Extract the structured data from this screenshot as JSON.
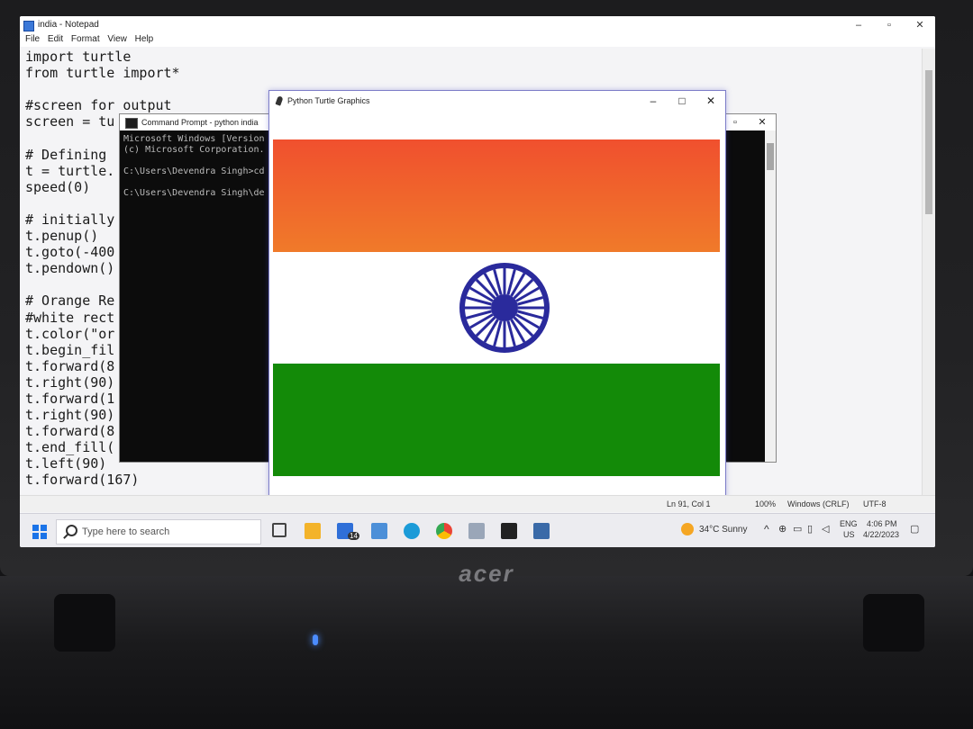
{
  "notepad": {
    "title": "india - Notepad",
    "menu": [
      "File",
      "Edit",
      "Format",
      "View",
      "Help"
    ],
    "code_lines": [
      "import turtle",
      "from turtle import*",
      "",
      "#screen for output",
      "screen = tu",
      "",
      "# Defining",
      "t = turtle.",
      "speed(0)",
      "",
      "# initially",
      "t.penup()",
      "t.goto(-400",
      "t.pendown()",
      "",
      "# Orange Re",
      "#white rect",
      "t.color(\"or",
      "t.begin_fil",
      "t.forward(8",
      "t.right(90)",
      "t.forward(1",
      "t.right(90)",
      "t.forward(8",
      "t.end_fill(",
      "t.left(90)",
      "t.forward(167)"
    ],
    "status": {
      "position": "Ln 91, Col 1",
      "zoom": "100%",
      "eol": "Windows (CRLF)",
      "encoding": "UTF-8"
    }
  },
  "cmd": {
    "title": "Command Prompt - python  india",
    "lines": [
      "Microsoft Windows [Version",
      "(c) Microsoft Corporation.",
      "",
      "C:\\Users\\Devendra Singh>cd",
      "",
      "C:\\Users\\Devendra Singh\\de"
    ]
  },
  "turtle": {
    "title": "Python Turtle Graphics",
    "colors": {
      "saffron": "#f0602c",
      "white": "#ffffff",
      "green": "#138a08",
      "chakra": "#2a2a9c"
    }
  },
  "taskbar": {
    "search_placeholder": "Type here to search",
    "mail_badge": "14",
    "weather": "34°C  Sunny",
    "lang": "ENG",
    "region": "US",
    "time": "4:06 PM",
    "date": "4/22/2023"
  },
  "laptop": {
    "brand": "acer"
  }
}
